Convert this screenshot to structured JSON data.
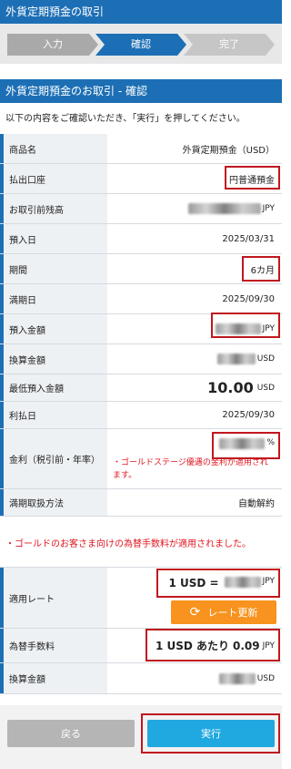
{
  "header": {
    "title": "外貨定期預金の取引"
  },
  "steps": [
    {
      "label": "入力",
      "active": false
    },
    {
      "label": "確認",
      "active": true
    },
    {
      "label": "完了",
      "active": false
    }
  ],
  "section": {
    "title": "外貨定期預金のお取引 - 確認"
  },
  "intro": "以下の内容をご確認いただき、「実行」を押してください。",
  "rows": {
    "product": {
      "label": "商品名",
      "value": "外貨定期預金（USD）"
    },
    "account": {
      "label": "払出口座",
      "value": "円普通預金"
    },
    "balance": {
      "label": "お取引前残高",
      "unit": "JPY"
    },
    "deposit_date": {
      "label": "預入日",
      "value": "2025/03/31"
    },
    "period": {
      "label": "期間",
      "value": "6カ月"
    },
    "maturity": {
      "label": "満期日",
      "value": "2025/09/30"
    },
    "deposit_amount": {
      "label": "預入金額",
      "unit": "JPY"
    },
    "converted": {
      "label": "換算金額",
      "unit": "USD"
    },
    "minimum": {
      "label": "最低預入金額",
      "value": "10.00",
      "unit": "USD"
    },
    "interest_date": {
      "label": "利払日",
      "value": "2025/09/30"
    },
    "rate": {
      "label": "金利（税引前・年率）",
      "unit": "%",
      "note": "・ゴールドステージ優遇の金利が適用されます。"
    },
    "maturity_method": {
      "label": "満期取扱方法",
      "value": "自動解約"
    },
    "applied_rate": {
      "label": "適用レート",
      "prefix": "1 USD =",
      "unit": "JPY"
    },
    "fee": {
      "label": "為替手数料",
      "prefix": "1 USD あたり",
      "value": "0.09",
      "unit": "JPY"
    },
    "converted2": {
      "label": "換算金額",
      "unit": "USD"
    }
  },
  "notice": "・ゴールドのお客さま向けの為替手数料が適用されました。",
  "buttons": {
    "rate_update": "レート更新",
    "back": "戻る",
    "execute": "実行"
  }
}
